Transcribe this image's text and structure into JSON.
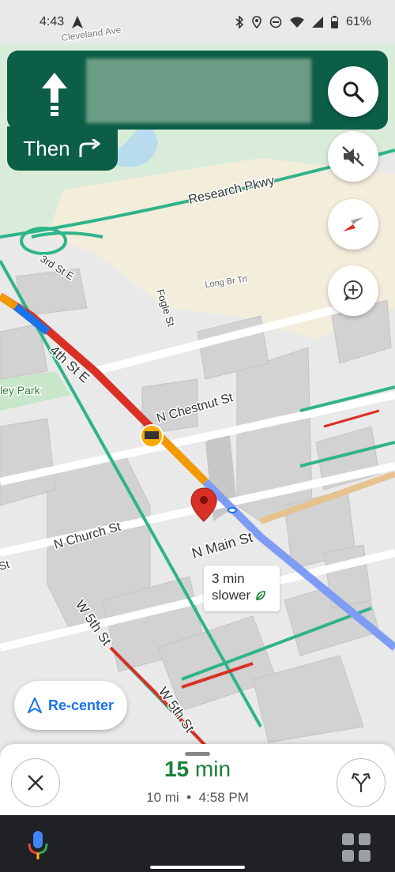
{
  "status": {
    "time": "4:43",
    "battery": "61%"
  },
  "map": {
    "street_labels": [
      "Research Pkwy",
      "3rd St E",
      "4th St E",
      "Fogle St",
      "N Chestnut St",
      "N Church St",
      "N Main St",
      "W 5th St",
      "W 5th St",
      "Long Br Trl",
      "Cleveland Ave",
      "ley Park",
      "St"
    ],
    "callout": {
      "line1": "3 min",
      "line2": "slower"
    }
  },
  "nav": {
    "then_label": "Then"
  },
  "recenter": {
    "label": "Re-center"
  },
  "trip": {
    "eta_value": "15",
    "eta_unit": "min",
    "distance": "10 mi",
    "separator": "•",
    "arrival": "4:58 PM"
  },
  "icons": {
    "direction_arrow": "arrow-up-icon",
    "search": "search-icon",
    "mute": "volume-off-icon",
    "compass": "compass-icon",
    "add_report": "add-report-icon",
    "close": "close-icon",
    "alt_routes": "alternate-routes-icon",
    "mic": "mic-icon",
    "apps": "apps-icon",
    "leaf": "leaf-icon"
  },
  "colors": {
    "nav_green": "#0c5e47",
    "eta_green": "#188038",
    "link_blue": "#1a73e8",
    "traffic_red": "#d93025",
    "traffic_orange": "#f29900"
  }
}
